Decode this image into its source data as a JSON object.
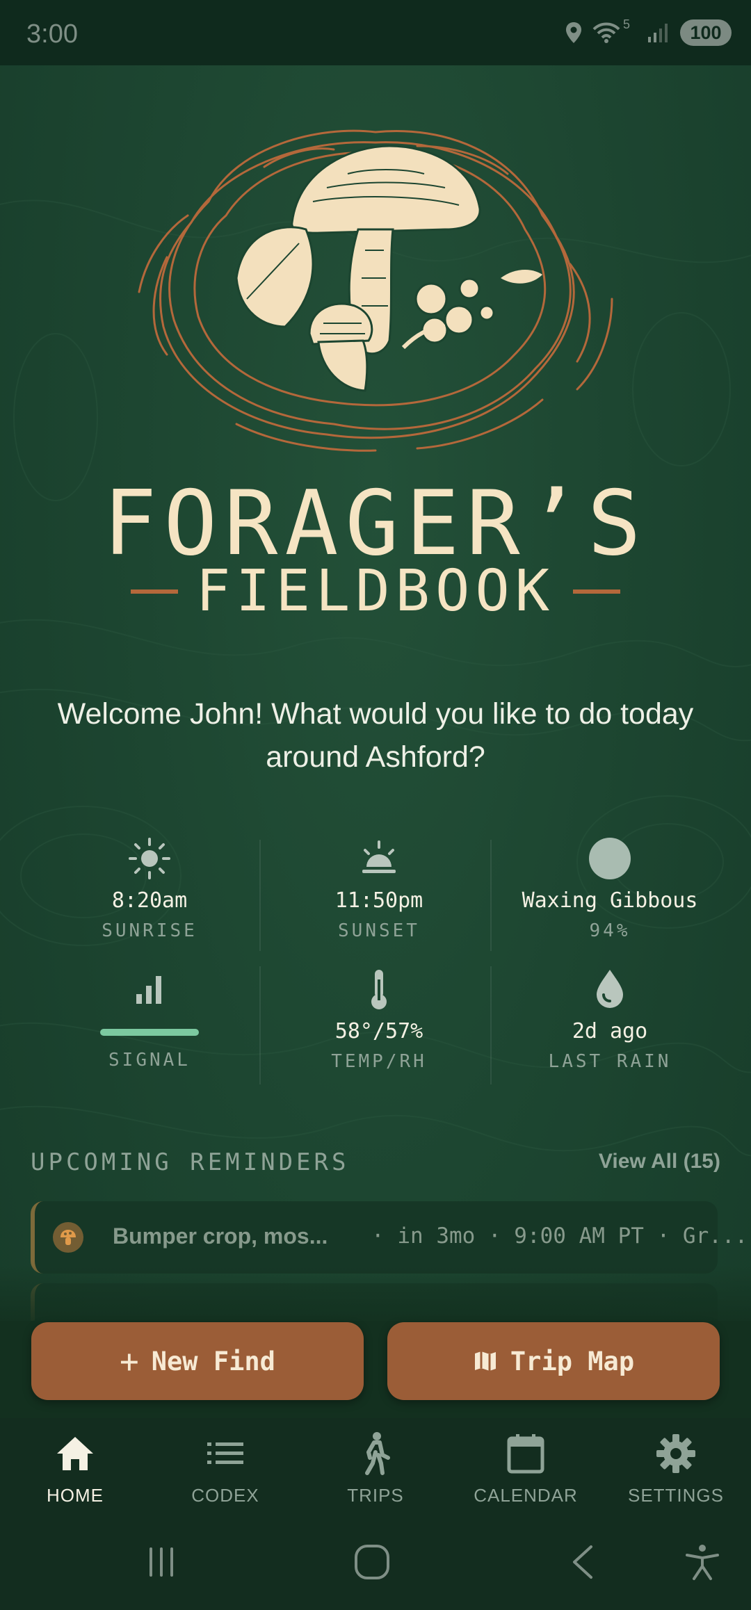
{
  "status_bar": {
    "time": "3:00",
    "wifi_label": "5",
    "battery": "100"
  },
  "brand": {
    "title": "FORAGER’S",
    "subtitle": "FIELDBOOK"
  },
  "welcome": "Welcome John! What would you like to do today around Ashford?",
  "stats": {
    "sunrise": {
      "value": "8:20am",
      "label": "SUNRISE",
      "icon": "sun-icon"
    },
    "sunset": {
      "value": "11:50pm",
      "label": "SUNSET",
      "icon": "sunset-icon"
    },
    "moon": {
      "value": "Waxing Gibbous",
      "label": "94%",
      "icon": "moon-icon"
    },
    "signal": {
      "label": "SIGNAL",
      "icon": "signal-bars-icon",
      "level": 1.0
    },
    "temp": {
      "value": "58°/57%",
      "label": "TEMP/RH",
      "icon": "thermometer-icon"
    },
    "rain": {
      "value": "2d ago",
      "label": "LAST RAIN",
      "icon": "drop-icon"
    }
  },
  "reminders": {
    "title": "UPCOMING REMINDERS",
    "view_all": "View All (15)",
    "items": [
      {
        "name": "Bumper crop, mos...",
        "meta": "· in 3mo · 9:00 AM PT · Gr...",
        "icon": "mushroom-icon"
      }
    ]
  },
  "actions": {
    "new_find": "New Find",
    "trip_map": "Trip Map"
  },
  "nav": {
    "items": [
      {
        "label": "HOME",
        "icon": "home-icon",
        "active": true
      },
      {
        "label": "CODEX",
        "icon": "list-icon"
      },
      {
        "label": "TRIPS",
        "icon": "walking-icon"
      },
      {
        "label": "CALENDAR",
        "icon": "calendar-icon"
      },
      {
        "label": "SETTINGS",
        "icon": "gear-icon"
      }
    ]
  },
  "colors": {
    "accent": "#9b5d37",
    "background": "#1c4530",
    "cream": "#f5e4c3",
    "muted": "#8fa397",
    "signal": "#7cc9a0"
  }
}
